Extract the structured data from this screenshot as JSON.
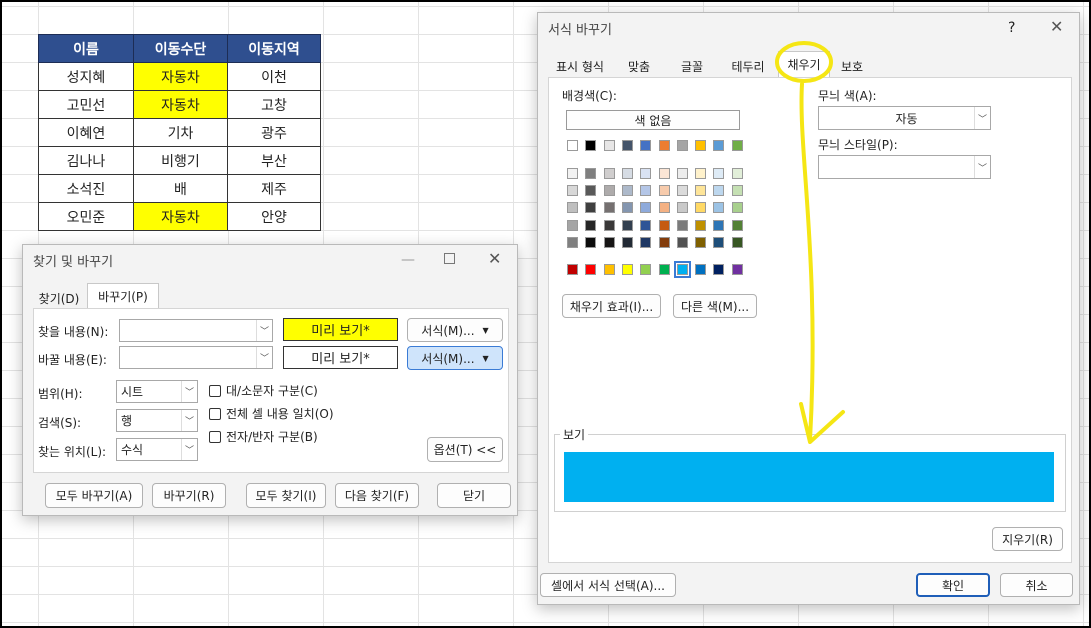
{
  "sheet": {
    "headers": [
      "이름",
      "이동수단",
      "이동지역"
    ],
    "rows": [
      [
        "성지혜",
        "자동차",
        "이천"
      ],
      [
        "고민선",
        "자동차",
        "고창"
      ],
      [
        "이혜연",
        "기차",
        "광주"
      ],
      [
        "김나나",
        "비행기",
        "부산"
      ],
      [
        "소석진",
        "배",
        "제주"
      ],
      [
        "오민준",
        "자동차",
        "안양"
      ]
    ],
    "highlight_color": "#ffff00",
    "header_color": "#2f4f8f"
  },
  "find": {
    "title": "찾기 및 바꾸기",
    "tab_find": "찾기(D)",
    "tab_replace": "바꾸기(P)",
    "find_label": "찾을 내용(N):",
    "replace_label": "바꿀 내용(E):",
    "find_value": "",
    "replace_value": "",
    "preview_find": "미리 보기*",
    "preview_replace": "미리 보기*",
    "format_button": "서식(M)...",
    "scope_label": "범위(H):",
    "scope_value": "시트",
    "search_label": "검색(S):",
    "search_value": "행",
    "lookin_label": "찾는 위치(L):",
    "lookin_value": "수식",
    "match_case": "대/소문자 구분(C)",
    "match_entire": "전체 셀 내용 일치(O)",
    "match_byte": "전자/반자 구분(B)",
    "options_button": "옵션(T) <<",
    "replace_all": "모두 바꾸기(A)",
    "replace": "바꾸기(R)",
    "find_all": "모두 찾기(I)",
    "find_next": "다음 찾기(F)",
    "close": "닫기"
  },
  "format": {
    "title": "서식 바꾸기",
    "help": "?",
    "close_x": "✕",
    "tabs": [
      "표시 형식",
      "맞춤",
      "글꼴",
      "테두리",
      "채우기",
      "보호"
    ],
    "bg_label": "배경색(C):",
    "no_color": "색 없음",
    "pattern_color_label": "무늬 색(A):",
    "pattern_color_value": "자동",
    "pattern_style_label": "무늬 스타일(P):",
    "pattern_style_value": "",
    "fill_effects": "채우기 효과(I)...",
    "more_colors": "다른 색(M)...",
    "sample_label": "보기",
    "sample_color": "#00b0f0",
    "clear": "지우기(R)",
    "choose_from_cell": "셀에서 서식 선택(A)...",
    "ok": "확인",
    "cancel": "취소",
    "theme_row": [
      "#ffffff",
      "#000000",
      "#e7e6e6",
      "#44546a",
      "#4472c4",
      "#ed7d31",
      "#a5a5a5",
      "#ffc000",
      "#5b9bd5",
      "#70ad47"
    ],
    "tint_rows": [
      [
        "#f2f2f2",
        "#7f7f7f",
        "#d0cece",
        "#d6dce4",
        "#d9e2f3",
        "#fbe5d5",
        "#ededed",
        "#fff2cc",
        "#deebf6",
        "#e2efd9"
      ],
      [
        "#d8d8d8",
        "#595959",
        "#aeabab",
        "#adb9ca",
        "#b4c6e7",
        "#f7cbac",
        "#dbdbdb",
        "#fee599",
        "#bdd7ee",
        "#c5e0b3"
      ],
      [
        "#bfbfbf",
        "#3f3f3f",
        "#757070",
        "#8496b0",
        "#8eaadb",
        "#f4b183",
        "#c9c9c9",
        "#ffd965",
        "#9cc3e5",
        "#a8d08d"
      ],
      [
        "#a5a5a5",
        "#262626",
        "#3a3838",
        "#323f4f",
        "#2f5496",
        "#c55a11",
        "#7b7b7b",
        "#bf9000",
        "#2e75b5",
        "#538135"
      ],
      [
        "#7f7f7f",
        "#0c0c0c",
        "#171616",
        "#222a35",
        "#1f3864",
        "#833c0b",
        "#525252",
        "#7f6000",
        "#1e4e79",
        "#375623"
      ]
    ],
    "standard_row": [
      "#c00000",
      "#ff0000",
      "#ffc000",
      "#ffff00",
      "#92d050",
      "#00b050",
      "#00b0f0",
      "#0070c0",
      "#002060",
      "#7030a0"
    ],
    "annotation_color": "#f5e614"
  }
}
